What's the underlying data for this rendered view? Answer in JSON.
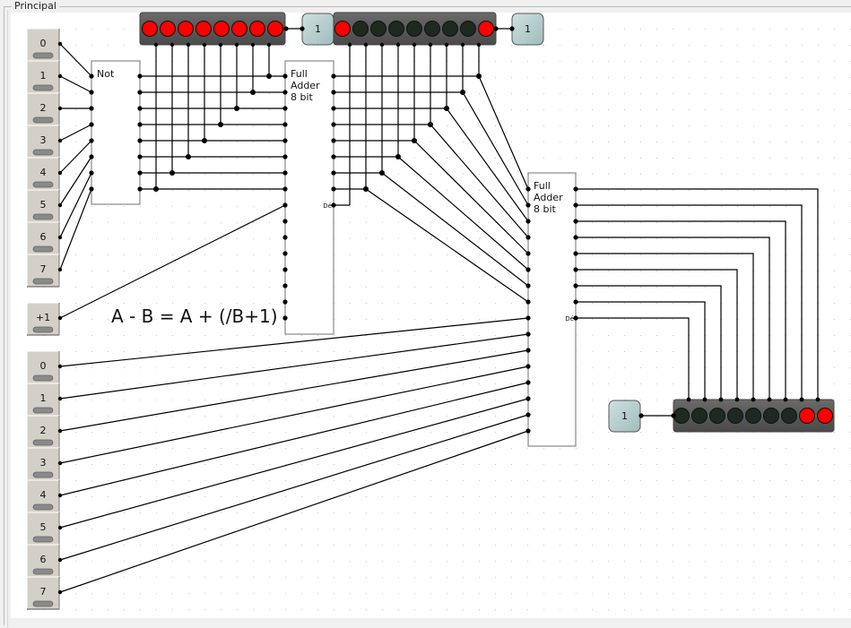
{
  "window": {
    "title": "Principal"
  },
  "switches_a": [
    "0",
    "1",
    "2",
    "3",
    "4",
    "5",
    "6",
    "7"
  ],
  "switch_plus_one": "+1",
  "switches_b": [
    "0",
    "1",
    "2",
    "3",
    "4",
    "5",
    "6",
    "7"
  ],
  "not_block": {
    "label": "Not"
  },
  "adder1": {
    "label_lines": [
      "Full",
      "Adder",
      "8 bit"
    ],
    "carry_label": "Dé"
  },
  "adder2": {
    "label_lines": [
      "Full",
      "Adder",
      "8 bit"
    ],
    "carry_label": "Dé"
  },
  "equation": "A - B = A + (/B+1)",
  "led_bar_top_left": {
    "leds": [
      true,
      true,
      true,
      true,
      true,
      true,
      true,
      true
    ],
    "box_label": "1"
  },
  "led_bar_top_right": {
    "leds": [
      true,
      false,
      false,
      false,
      false,
      false,
      false,
      false,
      true
    ],
    "box_label": "1"
  },
  "led_bar_result": {
    "leds": [
      false,
      false,
      false,
      false,
      false,
      false,
      false,
      true,
      true
    ],
    "box_label": "1"
  },
  "colors": {
    "led_on": "#ff0000",
    "led_off": "#1e2a1e",
    "switch": "#d4d0c8",
    "box": "#b4cccc"
  }
}
